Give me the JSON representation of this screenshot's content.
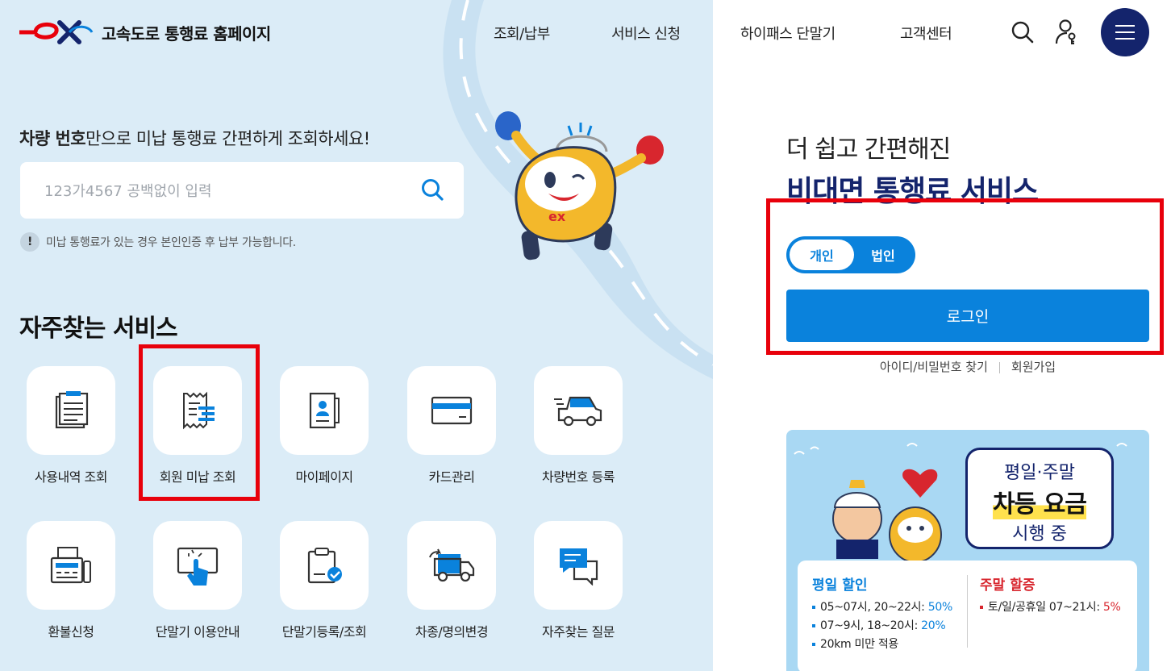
{
  "header": {
    "logo_text": "고속도로 통행료 홈페이지",
    "nav": [
      "조회/납부",
      "서비스 신청",
      "하이패스 단말기",
      "고객센터"
    ]
  },
  "search": {
    "headline_bold": "차량 번호",
    "headline_rest": "만으로 미납 통행료 간편하게 조회하세요!",
    "placeholder": "123가4567 공백없이 입력",
    "notice_badge": "!",
    "notice": "미납 통행료가 있는 경우 본인인증 후 납부 가능합니다."
  },
  "services": {
    "title": "자주찾는 서비스",
    "items": [
      {
        "label": "사용내역 조회",
        "icon": "document-list-icon"
      },
      {
        "label": "회원 미납 조회",
        "icon": "receipt-icon"
      },
      {
        "label": "마이페이지",
        "icon": "profile-book-icon"
      },
      {
        "label": "카드관리",
        "icon": "card-icon"
      },
      {
        "label": "차량번호 등록",
        "icon": "car-icon"
      },
      {
        "label": "환불신청",
        "icon": "fax-machine-icon"
      },
      {
        "label": "단말기 이용안내",
        "icon": "touch-screen-icon"
      },
      {
        "label": "단말기등록/조회",
        "icon": "clipboard-check-icon"
      },
      {
        "label": "차종/명의변경",
        "icon": "truck-icon"
      },
      {
        "label": "자주찾는 질문",
        "icon": "chat-icon"
      }
    ]
  },
  "login": {
    "subtitle": "더 쉽고 간편해진",
    "title": "비대면 통행료 서비스",
    "toggle_personal": "개인",
    "toggle_corporate": "법인",
    "login_button": "로그인",
    "find_link": "아이디/비밀번호 찾기",
    "signup_link": "회원가입"
  },
  "banner": {
    "line1": "평일·주말",
    "line2": "차등 요금",
    "line3": "시행 중",
    "weekday_title": "평일 할인",
    "weekday_items": [
      {
        "text": "05~07시, 20~22시: ",
        "value": "50%"
      },
      {
        "text": "07~9시, 18~20시: ",
        "value": "20%"
      },
      {
        "text": "20km 미만 적용",
        "value": ""
      }
    ],
    "weekend_title": "주말 할증",
    "weekend_items": [
      {
        "text": "토/일/공휴일 07~21시: ",
        "value": "5%"
      }
    ]
  },
  "colors": {
    "brand_navy": "#14246c",
    "accent_blue": "#0a82dc",
    "brand_red": "#e8000b",
    "left_bg": "#dbecf7"
  }
}
